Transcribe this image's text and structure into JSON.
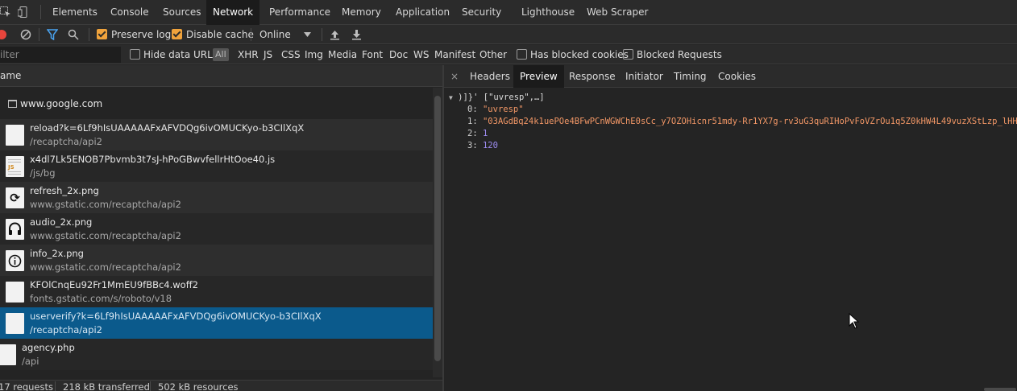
{
  "tabs": [
    {
      "label": "Elements"
    },
    {
      "label": "Console"
    },
    {
      "label": "Sources"
    },
    {
      "label": "Network"
    },
    {
      "label": "Performance"
    },
    {
      "label": "Memory"
    },
    {
      "label": "Application"
    },
    {
      "label": "Security"
    },
    {
      "label": "Lighthouse"
    },
    {
      "label": "Web Scraper"
    }
  ],
  "toolbar": {
    "preserve_log": "Preserve log",
    "disable_cache": "Disable cache",
    "throttle": "Online"
  },
  "filter": {
    "placeholder": "ilter",
    "hide_data_urls": "Hide data URLs",
    "types": [
      "All",
      "XHR",
      "JS",
      "CSS",
      "Img",
      "Media",
      "Font",
      "Doc",
      "WS",
      "Manifest",
      "Other"
    ],
    "has_blocked_cookies": "Has blocked cookies",
    "blocked_requests": "Blocked Requests"
  },
  "list": {
    "header": "ame",
    "group": "www.google.com",
    "rows": [
      {
        "name": "reload?k=6Lf9hIsUAAAAAFxAFVDQg6ivOMUCKyo-b3CIlXqX",
        "path": "/recaptcha/api2",
        "icon": "blank"
      },
      {
        "name": "x4dl7Lk5ENOB7Pbvmb3t7sJ-hPoGBwvfellrHtOoe40.js",
        "path": "/js/bg",
        "icon": "js"
      },
      {
        "name": "refresh_2x.png",
        "path": "www.gstatic.com/recaptcha/api2",
        "icon": "refresh"
      },
      {
        "name": "audio_2x.png",
        "path": "www.gstatic.com/recaptcha/api2",
        "icon": "headphones"
      },
      {
        "name": "info_2x.png",
        "path": "www.gstatic.com/recaptcha/api2",
        "icon": "info"
      },
      {
        "name": "KFOlCnqEu92Fr1MmEU9fBBc4.woff2",
        "path": "fonts.gstatic.com/s/roboto/v18",
        "icon": "blank"
      },
      {
        "name": "userverify?k=6Lf9hIsUAAAAAFxAFVDQg6ivOMUCKyo-b3CIlXqX",
        "path": "/recaptcha/api2",
        "icon": "blank",
        "selected": true
      },
      {
        "name": "agency.php",
        "path": "/api",
        "icon": "blank"
      }
    ]
  },
  "status": {
    "requests": "17 requests",
    "transferred": "218 kB transferred",
    "resources": "502 kB resources"
  },
  "detail": {
    "close": "×",
    "tabs": [
      {
        "label": "Headers"
      },
      {
        "label": "Preview"
      },
      {
        "label": "Response"
      },
      {
        "label": "Initiator"
      },
      {
        "label": "Timing"
      },
      {
        "label": "Cookies"
      }
    ],
    "preview": {
      "root": ")]}' [\"uvresp\",…]",
      "k0": "0:",
      "v0": "\"uvresp\"",
      "k1": "1:",
      "v1": "\"03AGdBq24k1uePOe4BFwPCnWGWChE0sCc_y7OZOHicnr51mdy-Rr1YX7g-rv3uG3quRIHoPvFoVZrOu1q5Z0kHW4L49vuzXStLzp_lHH",
      "k2": "2:",
      "v2": "1",
      "k3": "3:",
      "v3": "120"
    }
  },
  "colors": {
    "accent": "#f0a33c",
    "selected_row": "#0b5a8c",
    "string": "#f29766",
    "number": "#9d8cf0"
  }
}
